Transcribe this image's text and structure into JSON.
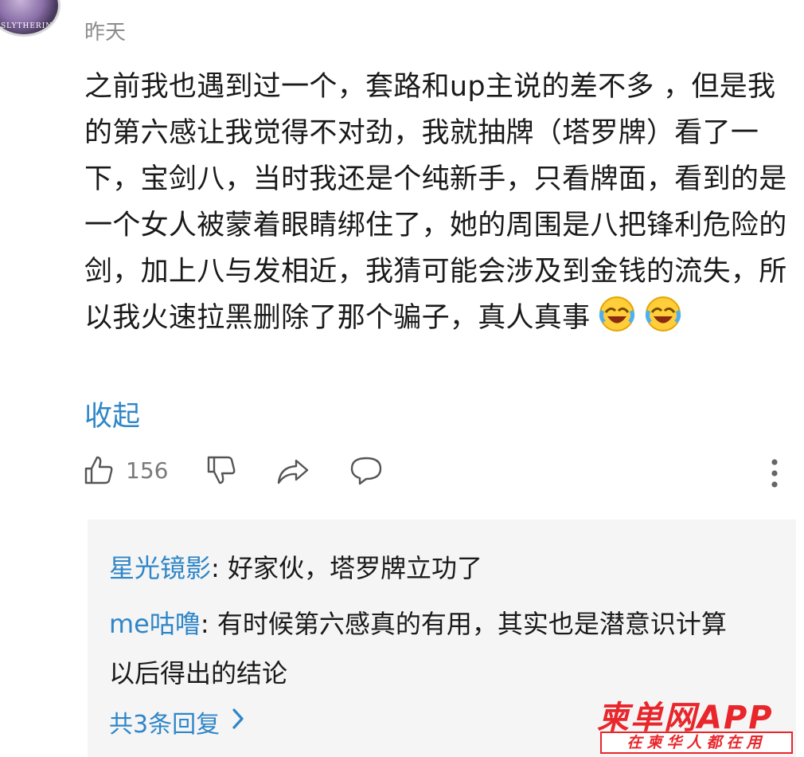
{
  "comment": {
    "avatar_text": "SLYTHERIN",
    "date": "昨天",
    "content": "之前我也遇到过一个，套路和up主说的差不多 ，但是我的第六感让我觉得不对劲，我就抽牌（塔罗牌）看了一下，宝剑八，当时我还是个纯新手，只看牌面，看到的是一个女人被蒙着眼睛绑住了，她的周围是八把锋利危险的剑，加上八与发相近，我猜可能会涉及到金钱的流失，所以我火速拉黑删除了那个骗子，真人真事",
    "emojis": [
      "laughing-crying-emoji",
      "laughing-crying-emoji"
    ],
    "collapse_label": "收起"
  },
  "actions": {
    "like_count": "156",
    "icons": [
      "thumbs-up-icon",
      "thumbs-down-icon",
      "share-icon",
      "comment-icon",
      "more-vertical-icon"
    ]
  },
  "replies": [
    {
      "name": "星光镜影",
      "text": ": 好家伙，塔罗牌立功了"
    },
    {
      "name": "me咕噜",
      "text": ": 有时候第六感真的有用，其实也是潜意识计算以后得出的结论"
    }
  ],
  "more_replies_label": "共3条回复",
  "watermark": {
    "top": "柬单网APP",
    "bottom": "在柬华人都在用"
  },
  "colors": {
    "link": "#2f86c8",
    "text": "#1a1a1a",
    "meta": "#8c8c8c",
    "reply_bg": "#f5f5f5",
    "watermark": "#e8262b"
  }
}
